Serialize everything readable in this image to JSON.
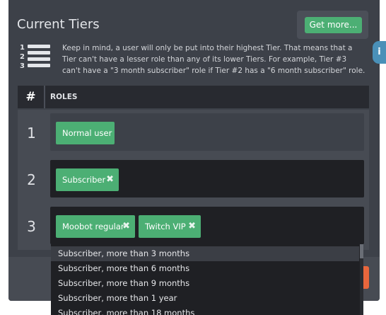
{
  "panel": {
    "title": "Current Tiers",
    "get_more_label": "Get more...",
    "info_text": "Keep in mind, a user will only be put into their highest Tier. That means that a Tier can't have a lesser role than any of its lower Tiers. For example, Tier #3 can't have a \"3 month subscriber\" role if Tier #2 has a \"6 month subscriber\" role.",
    "info_tab_label": "i",
    "list_icon_numbers": [
      "1",
      "2",
      "3"
    ]
  },
  "table": {
    "headers": {
      "num": "#",
      "roles": "ROLES"
    },
    "rows": [
      {
        "num": "1",
        "roles": [
          {
            "label": "Normal user",
            "removable": false
          }
        ]
      },
      {
        "num": "2",
        "roles": [
          {
            "label": "Subscriber",
            "removable": true
          }
        ]
      },
      {
        "num": "3",
        "roles": [
          {
            "label": "Moobot regular",
            "removable": true
          },
          {
            "label": "Twitch VIP",
            "removable": true
          }
        ]
      }
    ]
  },
  "remove_glyph": "✖",
  "dropdown": {
    "options": [
      "Subscriber, more than 3 months",
      "Subscriber, more than 6 months",
      "Subscriber, more than 9 months",
      "Subscriber, more than 1 year",
      "Subscriber, more than 18 months"
    ],
    "highlighted_index": 0
  },
  "colors": {
    "panel_bg": "#3d4149",
    "tag_green": "#4caf74",
    "accent_orange": "#e8663c",
    "info_blue": "#4a90b8",
    "dropdown_bg": "#1f2024"
  }
}
